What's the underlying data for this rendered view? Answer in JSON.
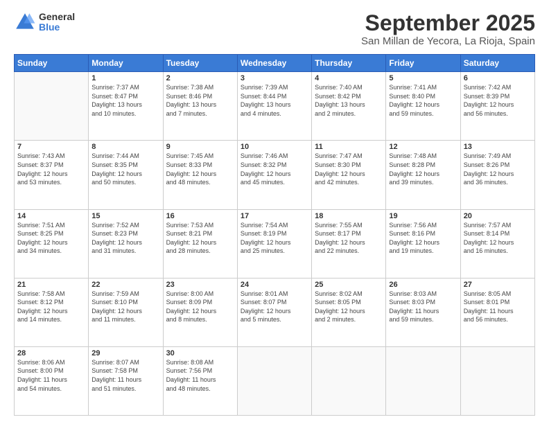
{
  "logo": {
    "general": "General",
    "blue": "Blue"
  },
  "title": "September 2025",
  "location": "San Millan de Yecora, La Rioja, Spain",
  "headers": [
    "Sunday",
    "Monday",
    "Tuesday",
    "Wednesday",
    "Thursday",
    "Friday",
    "Saturday"
  ],
  "weeks": [
    [
      {
        "day": "",
        "info": ""
      },
      {
        "day": "1",
        "info": "Sunrise: 7:37 AM\nSunset: 8:47 PM\nDaylight: 13 hours\nand 10 minutes."
      },
      {
        "day": "2",
        "info": "Sunrise: 7:38 AM\nSunset: 8:46 PM\nDaylight: 13 hours\nand 7 minutes."
      },
      {
        "day": "3",
        "info": "Sunrise: 7:39 AM\nSunset: 8:44 PM\nDaylight: 13 hours\nand 4 minutes."
      },
      {
        "day": "4",
        "info": "Sunrise: 7:40 AM\nSunset: 8:42 PM\nDaylight: 13 hours\nand 2 minutes."
      },
      {
        "day": "5",
        "info": "Sunrise: 7:41 AM\nSunset: 8:40 PM\nDaylight: 12 hours\nand 59 minutes."
      },
      {
        "day": "6",
        "info": "Sunrise: 7:42 AM\nSunset: 8:39 PM\nDaylight: 12 hours\nand 56 minutes."
      }
    ],
    [
      {
        "day": "7",
        "info": "Sunrise: 7:43 AM\nSunset: 8:37 PM\nDaylight: 12 hours\nand 53 minutes."
      },
      {
        "day": "8",
        "info": "Sunrise: 7:44 AM\nSunset: 8:35 PM\nDaylight: 12 hours\nand 50 minutes."
      },
      {
        "day": "9",
        "info": "Sunrise: 7:45 AM\nSunset: 8:33 PM\nDaylight: 12 hours\nand 48 minutes."
      },
      {
        "day": "10",
        "info": "Sunrise: 7:46 AM\nSunset: 8:32 PM\nDaylight: 12 hours\nand 45 minutes."
      },
      {
        "day": "11",
        "info": "Sunrise: 7:47 AM\nSunset: 8:30 PM\nDaylight: 12 hours\nand 42 minutes."
      },
      {
        "day": "12",
        "info": "Sunrise: 7:48 AM\nSunset: 8:28 PM\nDaylight: 12 hours\nand 39 minutes."
      },
      {
        "day": "13",
        "info": "Sunrise: 7:49 AM\nSunset: 8:26 PM\nDaylight: 12 hours\nand 36 minutes."
      }
    ],
    [
      {
        "day": "14",
        "info": "Sunrise: 7:51 AM\nSunset: 8:25 PM\nDaylight: 12 hours\nand 34 minutes."
      },
      {
        "day": "15",
        "info": "Sunrise: 7:52 AM\nSunset: 8:23 PM\nDaylight: 12 hours\nand 31 minutes."
      },
      {
        "day": "16",
        "info": "Sunrise: 7:53 AM\nSunset: 8:21 PM\nDaylight: 12 hours\nand 28 minutes."
      },
      {
        "day": "17",
        "info": "Sunrise: 7:54 AM\nSunset: 8:19 PM\nDaylight: 12 hours\nand 25 minutes."
      },
      {
        "day": "18",
        "info": "Sunrise: 7:55 AM\nSunset: 8:17 PM\nDaylight: 12 hours\nand 22 minutes."
      },
      {
        "day": "19",
        "info": "Sunrise: 7:56 AM\nSunset: 8:16 PM\nDaylight: 12 hours\nand 19 minutes."
      },
      {
        "day": "20",
        "info": "Sunrise: 7:57 AM\nSunset: 8:14 PM\nDaylight: 12 hours\nand 16 minutes."
      }
    ],
    [
      {
        "day": "21",
        "info": "Sunrise: 7:58 AM\nSunset: 8:12 PM\nDaylight: 12 hours\nand 14 minutes."
      },
      {
        "day": "22",
        "info": "Sunrise: 7:59 AM\nSunset: 8:10 PM\nDaylight: 12 hours\nand 11 minutes."
      },
      {
        "day": "23",
        "info": "Sunrise: 8:00 AM\nSunset: 8:09 PM\nDaylight: 12 hours\nand 8 minutes."
      },
      {
        "day": "24",
        "info": "Sunrise: 8:01 AM\nSunset: 8:07 PM\nDaylight: 12 hours\nand 5 minutes."
      },
      {
        "day": "25",
        "info": "Sunrise: 8:02 AM\nSunset: 8:05 PM\nDaylight: 12 hours\nand 2 minutes."
      },
      {
        "day": "26",
        "info": "Sunrise: 8:03 AM\nSunset: 8:03 PM\nDaylight: 11 hours\nand 59 minutes."
      },
      {
        "day": "27",
        "info": "Sunrise: 8:05 AM\nSunset: 8:01 PM\nDaylight: 11 hours\nand 56 minutes."
      }
    ],
    [
      {
        "day": "28",
        "info": "Sunrise: 8:06 AM\nSunset: 8:00 PM\nDaylight: 11 hours\nand 54 minutes."
      },
      {
        "day": "29",
        "info": "Sunrise: 8:07 AM\nSunset: 7:58 PM\nDaylight: 11 hours\nand 51 minutes."
      },
      {
        "day": "30",
        "info": "Sunrise: 8:08 AM\nSunset: 7:56 PM\nDaylight: 11 hours\nand 48 minutes."
      },
      {
        "day": "",
        "info": ""
      },
      {
        "day": "",
        "info": ""
      },
      {
        "day": "",
        "info": ""
      },
      {
        "day": "",
        "info": ""
      }
    ]
  ]
}
